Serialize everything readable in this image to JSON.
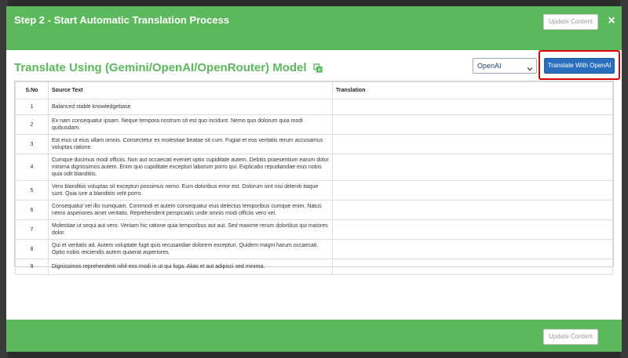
{
  "header": {
    "title": "Step 2 - Start Automatic Translation Process",
    "update_label": "Update Content"
  },
  "section": {
    "title": "Translate Using (Gemini/OpenAI/OpenRouter) Model"
  },
  "model_select": {
    "selected": "OpenAI"
  },
  "translate_button": {
    "label": "Translate With OpenAI"
  },
  "table": {
    "columns": [
      "S.No",
      "Source Text",
      "Translation"
    ],
    "rows": [
      {
        "sno": "1",
        "source": "Balanced stable knowledgebase",
        "translation": ""
      },
      {
        "sno": "2",
        "source": "Ex nam consequatur ipsam. Neque tempora nostrum sit est quo incidunt. Nemo quo dolorum quia modi quibusdam.",
        "translation": ""
      },
      {
        "sno": "3",
        "source": "Est eius ut eius ullam omnis. Consectetur ex molestiae beatae sit cum. Fugiat et eos veritatis rerum accusamus voluptas ratione.",
        "translation": ""
      },
      {
        "sno": "4",
        "source": "Cumque ducimus modi officiis. Non aut occaecati eveniet optio cupiditate autem. Debitis praesentium earum dolor minima dignissimos autem. Enim quo cupiditate excepturi laborum porro qui. Explicabo repudiandae eius nobis quia odit blanditiis.",
        "translation": ""
      },
      {
        "sno": "5",
        "source": "Vero blanditiis voluptas sit excepturi possimus nemo. Eum doloribus error est. Dolorum sint nisi deleniti itaque sunt. Quia iure a blanditiis velit porro.",
        "translation": ""
      },
      {
        "sno": "6",
        "source": "Consequatur vel illo numquam. Commodi et autem consequatur eius delectus temporibus cumque enim. Natus nemo asperiores amet veritatis. Reprehenderit perspiciatis unde omnis modi officiis vero vel.",
        "translation": ""
      },
      {
        "sno": "7",
        "source": "Molestiae ut sequi aut vero. Veniam hic ratione quia temporibus aut aut. Sed maxime rerum doloribus qui maiores dolor.",
        "translation": ""
      },
      {
        "sno": "8",
        "source": "Qui et veritatis ad. Autem voluptate fugit quis recusandae dolorem excepturi. Quidem magni harum occaecati. Optio nobis reiciendis autem quaerat asperiores.",
        "translation": ""
      },
      {
        "sno": "9",
        "source": "Dignissimos reprehenderit nihil eos modi in ut qui fuga. Alias et aut adipisci sed minima.",
        "translation": ""
      }
    ]
  },
  "footer": {
    "update_label": "Update Content"
  },
  "colors": {
    "header_green": "#5cb85c",
    "primary_blue": "#2a6fbd",
    "highlight_red": "#d90000"
  },
  "icons": {
    "close": "close-icon",
    "copy": "copy-icon",
    "dropdown": "chevron-down-icon"
  }
}
